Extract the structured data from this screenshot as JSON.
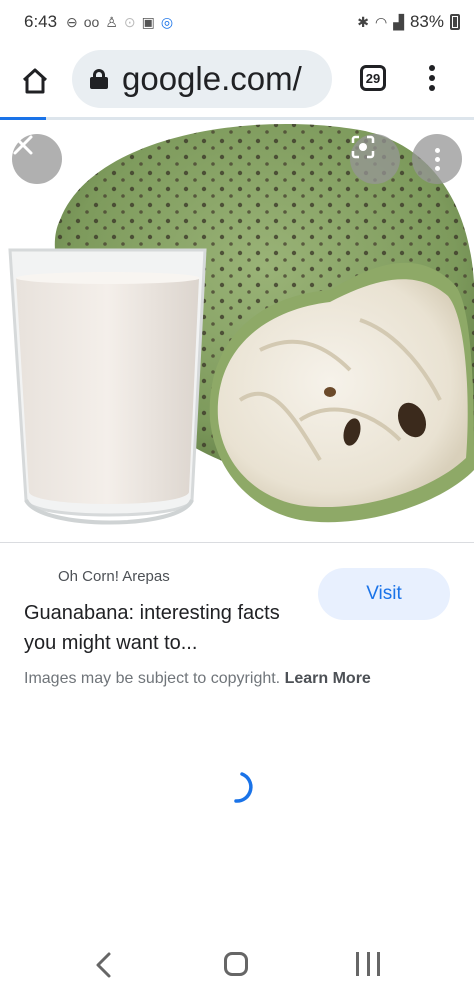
{
  "status_bar": {
    "time": "6:43",
    "battery": "83%",
    "left_icons": [
      "do-not-disturb-icon",
      "voicemail-icon",
      "person-icon",
      "dot-icon",
      "gallery-icon",
      "watch-icon"
    ],
    "right_icons": [
      "bluetooth-icon",
      "wifi-icon",
      "signal-icon"
    ]
  },
  "toolbar": {
    "url": "google.com/",
    "tab_count": "29",
    "accent": "#1a73e8"
  },
  "image_viewer": {
    "subject": "soursop-fruit-with-drink"
  },
  "result": {
    "source": "Oh Corn! Arepas",
    "title": "Guanabana: interesting facts you might want to...",
    "visit_label": "Visit",
    "copyright_text": "Images may be subject to copyright.",
    "learn_more_label": "Learn More"
  },
  "nav_bar": {
    "items": [
      "back-icon",
      "home-icon",
      "recents-icon"
    ]
  }
}
